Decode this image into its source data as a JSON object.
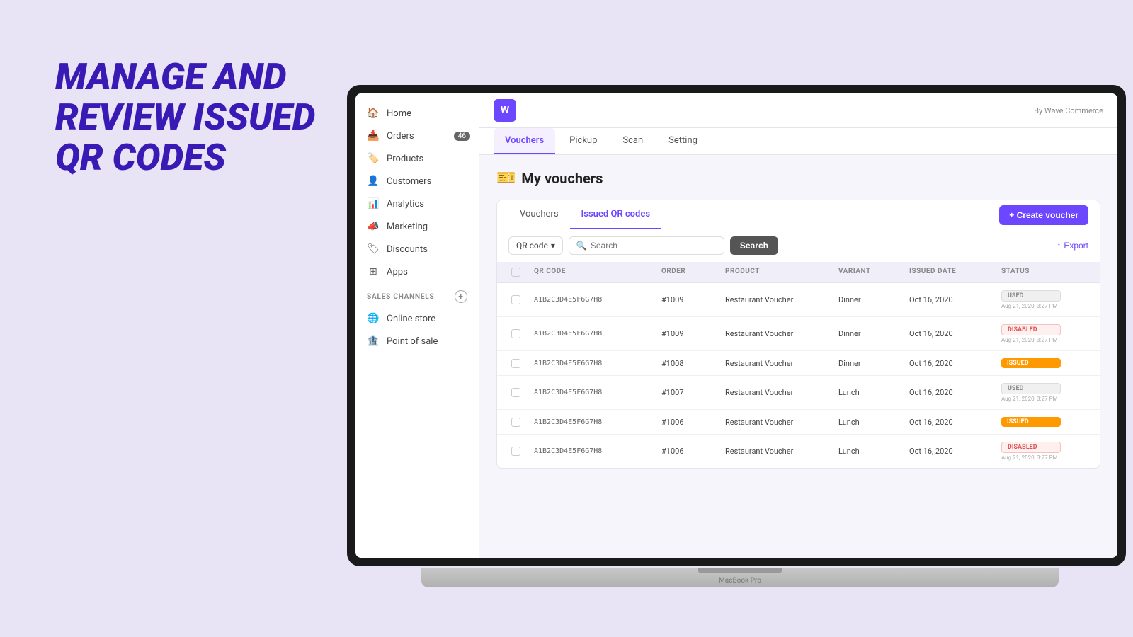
{
  "hero": {
    "title_line1": "MANAGE AND",
    "title_line2": "REVIEW ISSUED",
    "title_line3": "QR CODES"
  },
  "app": {
    "logo_text": "W",
    "brand": "By Wave Commerce"
  },
  "tabs": {
    "items": [
      "Vouchers",
      "Pickup",
      "Scan",
      "Setting"
    ],
    "active": "Vouchers"
  },
  "page": {
    "title": "My vouchers",
    "title_icon": "🎫"
  },
  "inner_tabs": {
    "items": [
      "Vouchers",
      "Issued QR codes"
    ],
    "active": "Issued QR codes"
  },
  "toolbar": {
    "qr_code_dropdown": "QR code",
    "search_placeholder": "Search",
    "search_button": "Search",
    "export_button": "Export",
    "create_button": "+ Create voucher"
  },
  "table": {
    "headers": [
      "",
      "QR CODE",
      "ORDER",
      "PRODUCT",
      "VARIANT",
      "ISSUED DATE",
      "STATUS"
    ],
    "rows": [
      {
        "qr_code": "A1B2C3D4E5F6G7H8",
        "order": "#1009",
        "product": "Restaurant Voucher",
        "variant": "Dinner",
        "issued_date": "Oct 16, 2020",
        "status": "used",
        "status_label": "USED",
        "status_date": "Aug 21, 2020, 3:27 PM"
      },
      {
        "qr_code": "A1B2C3D4E5F6G7H8",
        "order": "#1009",
        "product": "Restaurant Voucher",
        "variant": "Dinner",
        "issued_date": "Oct 16, 2020",
        "status": "disabled",
        "status_label": "DISABLED",
        "status_date": "Aug 21, 2020, 3:27 PM"
      },
      {
        "qr_code": "A1B2C3D4E5F6G7H8",
        "order": "#1008",
        "product": "Restaurant Voucher",
        "variant": "Dinner",
        "issued_date": "Oct 16, 2020",
        "status": "issued",
        "status_label": "ISSUED",
        "status_date": ""
      },
      {
        "qr_code": "A1B2C3D4E5F6G7H8",
        "order": "#1007",
        "product": "Restaurant Voucher",
        "variant": "Lunch",
        "issued_date": "Oct 16, 2020",
        "status": "used",
        "status_label": "USED",
        "status_date": "Aug 21, 2020, 3:27 PM"
      },
      {
        "qr_code": "A1B2C3D4E5F6G7H8",
        "order": "#1006",
        "product": "Restaurant Voucher",
        "variant": "Lunch",
        "issued_date": "Oct 16, 2020",
        "status": "issued",
        "status_label": "ISSUED",
        "status_date": ""
      },
      {
        "qr_code": "A1B2C3D4E5F6G7H8",
        "order": "#1006",
        "product": "Restaurant Voucher",
        "variant": "Lunch",
        "issued_date": "Oct 16, 2020",
        "status": "disabled",
        "status_label": "DISABLED",
        "status_date": "Aug 21, 2020, 3:27 PM"
      }
    ]
  },
  "sidebar": {
    "nav_items": [
      {
        "label": "Home",
        "icon": "🏠"
      },
      {
        "label": "Orders",
        "icon": "📥",
        "badge": "46"
      },
      {
        "label": "Products",
        "icon": "🏷️"
      },
      {
        "label": "Customers",
        "icon": "👤"
      },
      {
        "label": "Analytics",
        "icon": "📊"
      },
      {
        "label": "Marketing",
        "icon": "📣"
      },
      {
        "label": "Discounts",
        "icon": "🏷"
      },
      {
        "label": "Apps",
        "icon": "⚙️"
      }
    ],
    "sales_channels_label": "SALES CHANNELS",
    "sales_channels": [
      {
        "label": "Online store",
        "icon": "🌐"
      },
      {
        "label": "Point of sale",
        "icon": "🏦"
      }
    ]
  },
  "macbook_label": "MacBook Pro"
}
